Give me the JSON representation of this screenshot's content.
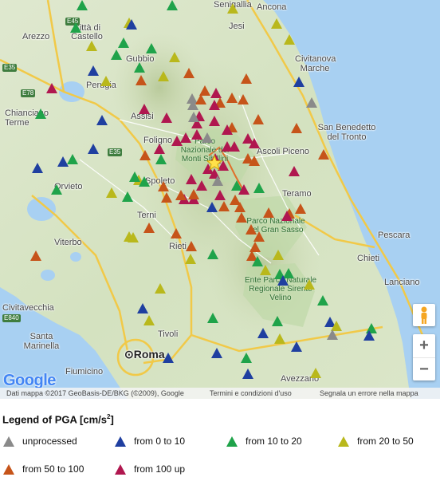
{
  "map": {
    "towns": [
      {
        "name": "Senigallia",
        "cls": ""
      },
      {
        "name": "Ancona",
        "cls": ""
      },
      {
        "name": "Jesi",
        "cls": ""
      },
      {
        "name": "Arezzo",
        "cls": ""
      },
      {
        "name": "Città di Castello",
        "cls": ""
      },
      {
        "name": "Gubbio",
        "cls": ""
      },
      {
        "name": "Civitanova Marche",
        "cls": ""
      },
      {
        "name": "Perugia",
        "cls": ""
      },
      {
        "name": "Assisi",
        "cls": ""
      },
      {
        "name": "Chianciano Terme",
        "cls": ""
      },
      {
        "name": "San Benedetto del Tronto",
        "cls": ""
      },
      {
        "name": "Foligno",
        "cls": ""
      },
      {
        "name": "Ascoli Piceno",
        "cls": ""
      },
      {
        "name": "Orvieto",
        "cls": ""
      },
      {
        "name": "Spoleto",
        "cls": ""
      },
      {
        "name": "Teramo",
        "cls": ""
      },
      {
        "name": "Terni",
        "cls": ""
      },
      {
        "name": "Pescara",
        "cls": ""
      },
      {
        "name": "Viterbo",
        "cls": ""
      },
      {
        "name": "Rieti",
        "cls": ""
      },
      {
        "name": "Chieti",
        "cls": ""
      },
      {
        "name": "Lanciano",
        "cls": ""
      },
      {
        "name": "Civitavecchia",
        "cls": ""
      },
      {
        "name": "Tivoli",
        "cls": ""
      },
      {
        "name": "Santa Marinella",
        "cls": ""
      },
      {
        "name": "Roma",
        "cls": "big"
      },
      {
        "name": "Fiumicino",
        "cls": ""
      },
      {
        "name": "Avezzano",
        "cls": ""
      }
    ],
    "parks": [
      "Parco Nazionale dei Monti Sibillini",
      "Parco Nazionale del Gran Sasso",
      "Ente Parco Naturale Regionale Sirente Velino"
    ],
    "roads": [
      "E35",
      "E78",
      "E35",
      "E45",
      "E80",
      "E840"
    ],
    "google_logo": "Google",
    "attribution": {
      "data": "Dati mappa ©2017 GeoBasis-DE/BKG (©2009), Google",
      "terms": "Termini e condizioni d'uso",
      "report": "Segnala un errore nella mappa"
    },
    "zoom_in": "+",
    "zoom_out": "−",
    "pegman_icon": "pegman-icon",
    "epicenter_icon": "star-icon"
  },
  "legend": {
    "title": "Legend of PGA [cm/s",
    "title_exp": "2",
    "title_end": "]",
    "items": [
      {
        "label": "unprocessed",
        "color": "#8a8a8a"
      },
      {
        "label": "from 0 to 10",
        "color": "#1f3fa0"
      },
      {
        "label": "from 10 to 20",
        "color": "#1fa34a"
      },
      {
        "label": "from 20 to 50",
        "color": "#b9b81c"
      },
      {
        "label": "from 50 to 100",
        "color": "#c6541a"
      },
      {
        "label": "from 100 up",
        "color": "#b0174f"
      }
    ]
  },
  "stations": [
    {
      "c": "green"
    },
    {
      "c": "green"
    },
    {
      "c": "yellow"
    },
    {
      "c": "green"
    },
    {
      "c": "yellow"
    },
    {
      "c": "blue"
    },
    {
      "c": "yellow"
    },
    {
      "c": "green"
    },
    {
      "c": "yellow"
    },
    {
      "c": "green"
    },
    {
      "c": "green"
    },
    {
      "c": "blue"
    },
    {
      "c": "yellow"
    },
    {
      "c": "yellow"
    },
    {
      "c": "green"
    },
    {
      "c": "orange"
    },
    {
      "c": "yellow"
    },
    {
      "c": "yellow"
    },
    {
      "c": "blue"
    },
    {
      "c": "orange"
    },
    {
      "c": "orange"
    },
    {
      "c": "magenta"
    },
    {
      "c": "orange"
    },
    {
      "c": "magenta"
    },
    {
      "c": "gray"
    },
    {
      "c": "gray"
    },
    {
      "c": "orange"
    },
    {
      "c": "orange"
    },
    {
      "c": "orange"
    },
    {
      "c": "gray"
    },
    {
      "c": "green"
    },
    {
      "c": "blue"
    },
    {
      "c": "magenta"
    },
    {
      "c": "magenta"
    },
    {
      "c": "magenta"
    },
    {
      "c": "orange"
    },
    {
      "c": "magenta"
    },
    {
      "c": "magenta"
    },
    {
      "c": "magenta"
    },
    {
      "c": "orange"
    },
    {
      "c": "magenta"
    },
    {
      "c": "orange"
    },
    {
      "c": "orange"
    },
    {
      "c": "blue"
    },
    {
      "c": "magenta"
    },
    {
      "c": "orange"
    },
    {
      "c": "magenta"
    },
    {
      "c": "blue"
    },
    {
      "c": "green"
    },
    {
      "c": "blue"
    },
    {
      "c": "magenta"
    },
    {
      "c": "gray"
    },
    {
      "c": "magenta"
    },
    {
      "c": "gray"
    },
    {
      "c": "magenta"
    },
    {
      "c": "magenta"
    },
    {
      "c": "orange"
    },
    {
      "c": "magenta"
    },
    {
      "c": "magenta"
    },
    {
      "c": "orange"
    },
    {
      "c": "green"
    },
    {
      "c": "yellow"
    },
    {
      "c": "magenta"
    },
    {
      "c": "magenta"
    },
    {
      "c": "magenta"
    },
    {
      "c": "magenta"
    },
    {
      "c": "magenta"
    },
    {
      "c": "orange"
    },
    {
      "c": "magenta"
    },
    {
      "c": "magenta"
    },
    {
      "c": "gray"
    },
    {
      "c": "green"
    },
    {
      "c": "yellow"
    },
    {
      "c": "green"
    },
    {
      "c": "orange"
    },
    {
      "c": "magenta"
    },
    {
      "c": "green"
    },
    {
      "c": "green"
    },
    {
      "c": "magenta"
    },
    {
      "c": "magenta"
    },
    {
      "c": "orange"
    },
    {
      "c": "orange"
    },
    {
      "c": "orange"
    },
    {
      "c": "green"
    },
    {
      "c": "green"
    },
    {
      "c": "magenta"
    },
    {
      "c": "orange"
    },
    {
      "c": "orange"
    },
    {
      "c": "orange"
    },
    {
      "c": "blue"
    },
    {
      "c": "orange"
    },
    {
      "c": "orange"
    },
    {
      "c": "orange"
    },
    {
      "c": "orange"
    },
    {
      "c": "orange"
    },
    {
      "c": "orange"
    },
    {
      "c": "orange"
    },
    {
      "c": "magenta"
    },
    {
      "c": "orange"
    },
    {
      "c": "yellow"
    },
    {
      "c": "yellow"
    },
    {
      "c": "orange"
    },
    {
      "c": "orange"
    },
    {
      "c": "orange"
    },
    {
      "c": "yellow"
    },
    {
      "c": "green"
    },
    {
      "c": "yellow"
    },
    {
      "c": "green"
    },
    {
      "c": "yellow"
    },
    {
      "c": "green"
    },
    {
      "c": "green"
    },
    {
      "c": "blue"
    },
    {
      "c": "yellow"
    },
    {
      "c": "yellow"
    },
    {
      "c": "green"
    },
    {
      "c": "blue"
    },
    {
      "c": "yellow"
    },
    {
      "c": "green"
    },
    {
      "c": "green"
    },
    {
      "c": "blue"
    },
    {
      "c": "yellow"
    },
    {
      "c": "green"
    },
    {
      "c": "blue"
    },
    {
      "c": "blue"
    },
    {
      "c": "blue"
    },
    {
      "c": "yellow"
    },
    {
      "c": "blue"
    },
    {
      "c": "gray"
    },
    {
      "c": "blue"
    },
    {
      "c": "green"
    },
    {
      "c": "blue"
    },
    {
      "c": "yellow"
    },
    {
      "c": "orange"
    }
  ]
}
